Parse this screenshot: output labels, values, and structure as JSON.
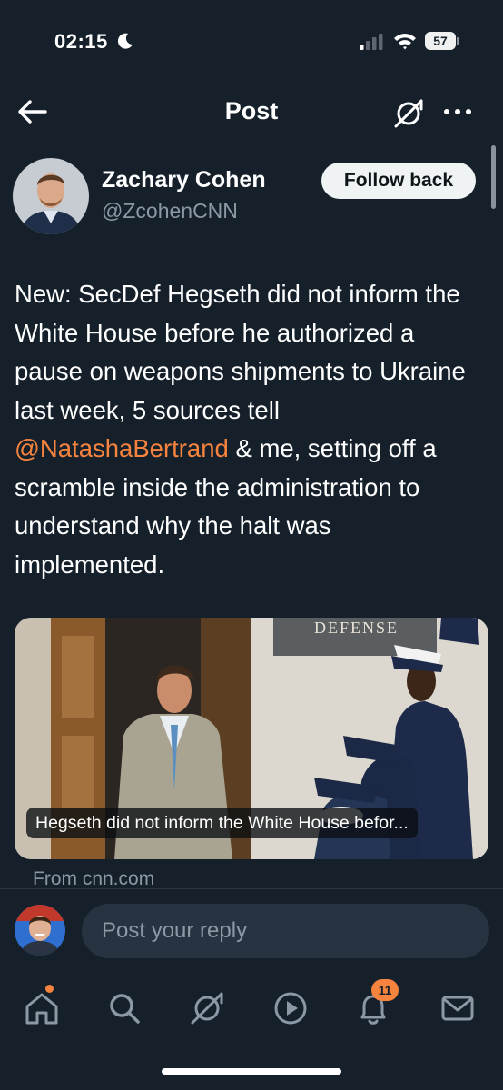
{
  "status_bar": {
    "time": "02:15",
    "battery": "57"
  },
  "header": {
    "title": "Post"
  },
  "author": {
    "name": "Zachary Cohen",
    "handle": "@ZcohenCNN",
    "follow_label": "Follow back"
  },
  "post": {
    "text_before": "New: SecDef Hegseth did not inform the White House before he authorized a pause on weapons shipments to Ukraine last week, 5 sources tell ",
    "mention": "@NatashaBertrand",
    "text_after": " & me, setting off a scramble inside the administration to understand why the halt was implemented."
  },
  "card": {
    "sign_text": "DEFENSE",
    "caption": "Hegseth did not inform the White House befor...",
    "source": "From cnn.com"
  },
  "reply": {
    "placeholder": "Post your reply"
  },
  "tabbar": {
    "notifications_count": "11",
    "items": [
      "home-icon",
      "search-icon",
      "grok-icon",
      "video-icon",
      "notifications-icon",
      "messages-icon"
    ]
  },
  "colors": {
    "background": "#15202b",
    "accent": "#f7843e",
    "secondary_text": "#8b98a5"
  }
}
